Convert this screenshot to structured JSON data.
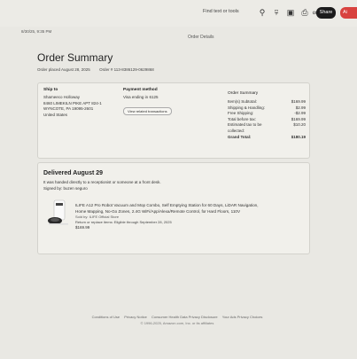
{
  "toolbar": {
    "find_label": "Find text or tools",
    "share_label": "Share",
    "red_button_label": "Ai"
  },
  "page_header": {
    "datetime": "8/30/25, 9:35 PM",
    "title": "Order Details"
  },
  "order": {
    "title": "Order Summary",
    "placed": "Order placed August 28, 2025",
    "number": "Order # 113-8386129-0629868"
  },
  "ship_to": {
    "heading": "Ship to",
    "lines": [
      "Shameeco Holloway",
      "8460 LIMEKILN PIKE APT 824-1",
      "WYNCOTE, PA 19095-2601",
      "United States"
    ]
  },
  "payment": {
    "heading": "Payment method",
    "card": "Visa  ending in 6125",
    "button": "View related transactions"
  },
  "summary": {
    "heading": "Order Summary",
    "rows": [
      {
        "label": "Item(s) Subtotal:",
        "value": "$169.99"
      },
      {
        "label": "Shipping & Handling:",
        "value": "$2.99"
      },
      {
        "label": "Free Shipping:",
        "value": "-$2.99"
      },
      {
        "label": "Total before tax:",
        "value": "$169.99"
      },
      {
        "label": "Estimated tax to be collected:",
        "value": "$10.20"
      },
      {
        "label": "Grand Total:",
        "value": "$180.19"
      }
    ]
  },
  "delivery": {
    "title": "Delivered August 29",
    "note": "It was handed directly to a receptionist or someone at a front desk.",
    "signed": "Signed by: buzen seguro",
    "product": {
      "name": "ILIFE A12 Pro Robot Vacuum and Mop Combo, Self Emptying Station for 60 Days, LiDAR Navigation, Home Mapping, No-Go Zones, 2.4G WiFi/App/Alexa/Remote Control, for Hard Floors, 110V",
      "sold_by": "Sold by: ILIFE Official Store",
      "return": "Return or replace items: Eligible through September 28, 2025",
      "price": "$169.99"
    }
  },
  "footer": {
    "links": [
      "Conditions of Use",
      "Privacy Notice",
      "Consumer Health Data Privacy Disclosure",
      "Your Ads Privacy Choices"
    ],
    "copyright": "© 1996-2025, Amazon.com, Inc. or its affiliates"
  }
}
